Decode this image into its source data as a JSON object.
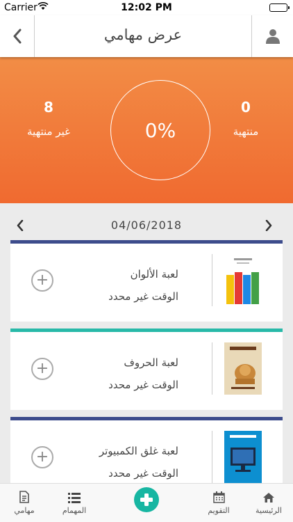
{
  "status_bar": {
    "carrier": "Carrier",
    "time": "12:02 PM"
  },
  "nav": {
    "title": "عرض مهامي"
  },
  "summary": {
    "finished_count": "0",
    "finished_label": "منتهية",
    "unfinished_count": "8",
    "unfinished_label": "غير منتهية",
    "progress": "0%"
  },
  "date_bar": {
    "date": "04/06/2018"
  },
  "tasks": [
    {
      "name": "لعبة الألوان",
      "time": "الوقت غير محدد",
      "stripe_color": "#3d4c8c"
    },
    {
      "name": "لعبة الحروف",
      "time": "الوقت غير محدد",
      "stripe_color": "#28b9a8"
    },
    {
      "name": "لعبة غلق الكمبيوتر",
      "time": "الوقت غير محدد",
      "stripe_color": "#3d4c8c"
    }
  ],
  "tabbar": {
    "my_tasks": "مهامي",
    "tasks": "المهمام",
    "calendar": "التقويم",
    "home": "الرئيسية"
  },
  "colors": {
    "accent": "#f06a30",
    "teal": "#17b6a2"
  }
}
